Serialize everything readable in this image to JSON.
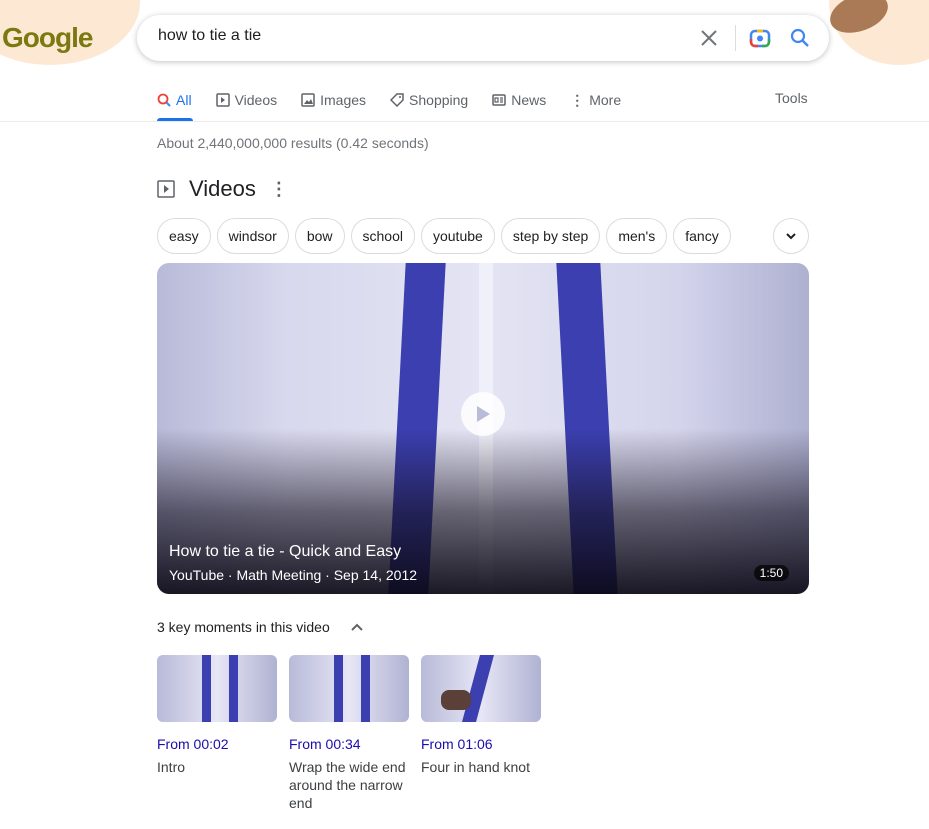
{
  "header": {
    "logo": "Google",
    "query": "how to tie a tie",
    "clear_icon": "close-icon",
    "lens_icon": "camera-lens-icon",
    "search_icon": "search-icon"
  },
  "tabs": [
    {
      "label": "All",
      "icon": "search-icon",
      "active": true
    },
    {
      "label": "Videos",
      "icon": "play-icon"
    },
    {
      "label": "Images",
      "icon": "image-icon"
    },
    {
      "label": "Shopping",
      "icon": "tag-icon"
    },
    {
      "label": "News",
      "icon": "news-icon"
    },
    {
      "label": "More",
      "icon": "more-vert-icon"
    }
  ],
  "tools": "Tools",
  "stats": "About 2,440,000,000 results (0.42 seconds)",
  "videos": {
    "heading": "Videos",
    "chips": [
      "easy",
      "windsor",
      "bow",
      "school",
      "youtube",
      "step by step",
      "men's",
      "fancy"
    ],
    "main": {
      "title": "How to tie a tie - Quick and Easy",
      "meta": "YouTube · Math Meeting · Sep 14, 2012",
      "duration": "1:50"
    },
    "key_moments_label": "3 key moments in this video",
    "moments": [
      {
        "time": "From 00:02",
        "desc": "Intro"
      },
      {
        "time": "From 00:34",
        "desc": "Wrap the wide end around the narrow end"
      },
      {
        "time": "From 01:06",
        "desc": "Four in hand knot"
      }
    ]
  },
  "colors": {
    "accent": "#1a73e8",
    "link": "#1a0dab"
  }
}
